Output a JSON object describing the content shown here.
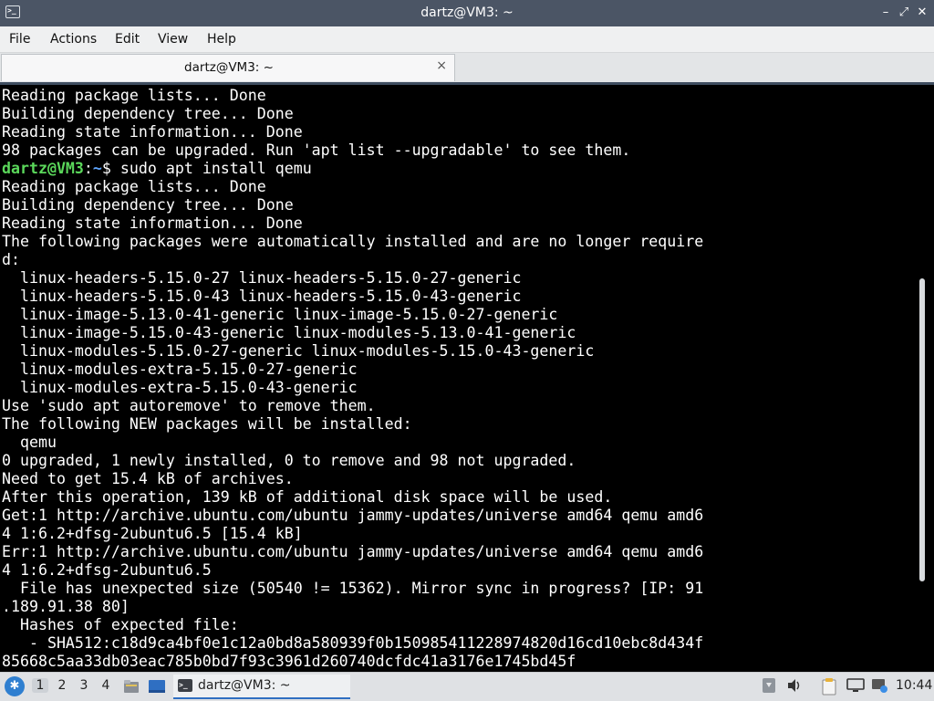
{
  "window": {
    "title": "dartz@VM3: ~",
    "controls": {
      "minimize": "–",
      "restore": "⤢",
      "close": "✕"
    }
  },
  "menu": [
    "File",
    "Actions",
    "Edit",
    "View",
    "Help"
  ],
  "tab": {
    "label": "dartz@VM3: ~",
    "close": "×"
  },
  "terminal": {
    "prompt": {
      "user_host": "dartz@VM3",
      "sep": ":",
      "path": "~",
      "symbol": "$"
    },
    "lines": [
      {
        "text": "Reading package lists... Done"
      },
      {
        "text": "Building dependency tree... Done"
      },
      {
        "text": "Reading state information... Done"
      },
      {
        "text": "98 packages can be upgraded. Run 'apt list --upgradable' to see them."
      },
      {
        "prompt": true,
        "text": " sudo apt install qemu"
      },
      {
        "text": "Reading package lists... Done"
      },
      {
        "text": "Building dependency tree... Done"
      },
      {
        "text": "Reading state information... Done"
      },
      {
        "text": "The following packages were automatically installed and are no longer require"
      },
      {
        "text": "d:"
      },
      {
        "text": "  linux-headers-5.15.0-27 linux-headers-5.15.0-27-generic"
      },
      {
        "text": "  linux-headers-5.15.0-43 linux-headers-5.15.0-43-generic"
      },
      {
        "text": "  linux-image-5.13.0-41-generic linux-image-5.15.0-27-generic"
      },
      {
        "text": "  linux-image-5.15.0-43-generic linux-modules-5.13.0-41-generic"
      },
      {
        "text": "  linux-modules-5.15.0-27-generic linux-modules-5.15.0-43-generic"
      },
      {
        "text": "  linux-modules-extra-5.15.0-27-generic"
      },
      {
        "text": "  linux-modules-extra-5.15.0-43-generic"
      },
      {
        "text": "Use 'sudo apt autoremove' to remove them."
      },
      {
        "text": "The following NEW packages will be installed:"
      },
      {
        "text": "  qemu"
      },
      {
        "text": "0 upgraded, 1 newly installed, 0 to remove and 98 not upgraded."
      },
      {
        "text": "Need to get 15.4 kB of archives."
      },
      {
        "text": "After this operation, 139 kB of additional disk space will be used."
      },
      {
        "text": "Get:1 http://archive.ubuntu.com/ubuntu jammy-updates/universe amd64 qemu amd6"
      },
      {
        "text": "4 1:6.2+dfsg-2ubuntu6.5 [15.4 kB]"
      },
      {
        "text": "Err:1 http://archive.ubuntu.com/ubuntu jammy-updates/universe amd64 qemu amd6"
      },
      {
        "text": "4 1:6.2+dfsg-2ubuntu6.5"
      },
      {
        "text": "  File has unexpected size (50540 != 15362). Mirror sync in progress? [IP: 91"
      },
      {
        "text": ".189.91.38 80]"
      },
      {
        "text": "  Hashes of expected file:"
      },
      {
        "text": "   - SHA512:c18d9ca4bf0e1c12a0bd8a580939f0b150985411228974820d16cd10ebc8d434f"
      },
      {
        "text": "85668c5aa33db03eac785b0bd7f93c3961d260740dcfdc41a3176e1745bd45f"
      }
    ]
  },
  "taskbar": {
    "start_icon": "lxqt-start-icon",
    "workspaces": [
      "1",
      "2",
      "3",
      "4"
    ],
    "active_workspace": "1",
    "quicklaunch": [
      "file-manager-icon",
      "show-desktop-icon"
    ],
    "task_label": "dartz@VM3: ~",
    "tray": [
      "clipboard-icon",
      "volume-icon",
      "notes-icon",
      "display-icon",
      "network-icon"
    ],
    "clock": "10:44"
  },
  "colors": {
    "titlebar": "#4b5565",
    "prompt_user": "#5bd85b",
    "prompt_path": "#5fa6ff",
    "terminal_bg": "#000000",
    "terminal_fg": "#ffffff"
  }
}
